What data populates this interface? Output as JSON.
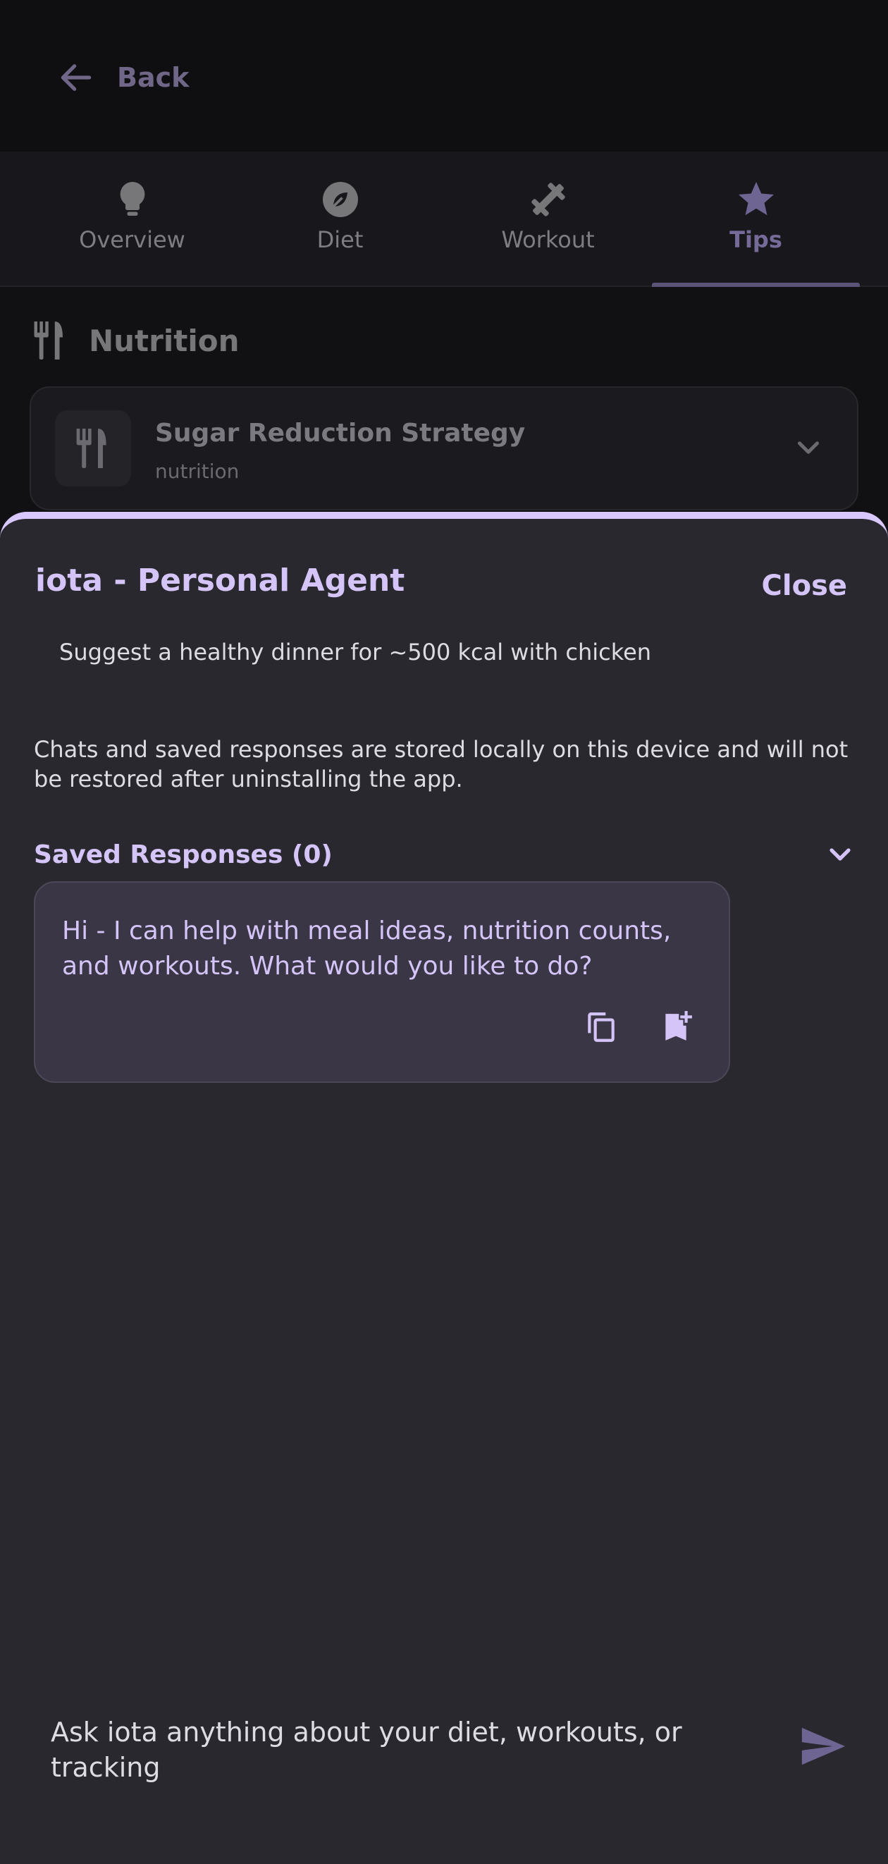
{
  "topbar": {
    "back_label": "Back"
  },
  "tabs": [
    {
      "label": "Overview",
      "icon": "lightbulb-icon",
      "active": false
    },
    {
      "label": "Diet",
      "icon": "leaf-icon",
      "active": false
    },
    {
      "label": "Workout",
      "icon": "dumbbell-icon",
      "active": false
    },
    {
      "label": "Tips",
      "icon": "star-icon",
      "active": true
    }
  ],
  "section": {
    "title": "Nutrition",
    "icon": "utensils-icon",
    "card": {
      "title": "Sugar Reduction Strategy",
      "subtitle": "nutrition",
      "icon": "utensils-icon"
    }
  },
  "sheet": {
    "title": "iota - Personal Agent",
    "close_label": "Close",
    "suggestion": "Suggest a healthy dinner for ~500 kcal with chicken",
    "notice": "Chats and saved responses are stored locally on this device and will not be restored after uninstalling the app.",
    "saved_label": "Saved Responses (0)",
    "message": "Hi - I can help with meal ideas, nutrition counts, and workouts. What would you like to do?",
    "input_placeholder": "Ask iota anything about your diet, workouts, or tracking"
  },
  "colors": {
    "accent": "#d4c4f7",
    "sheet_bg": "#29282e",
    "bubble_bg": "#3b3645",
    "page_bg": "#111114"
  }
}
